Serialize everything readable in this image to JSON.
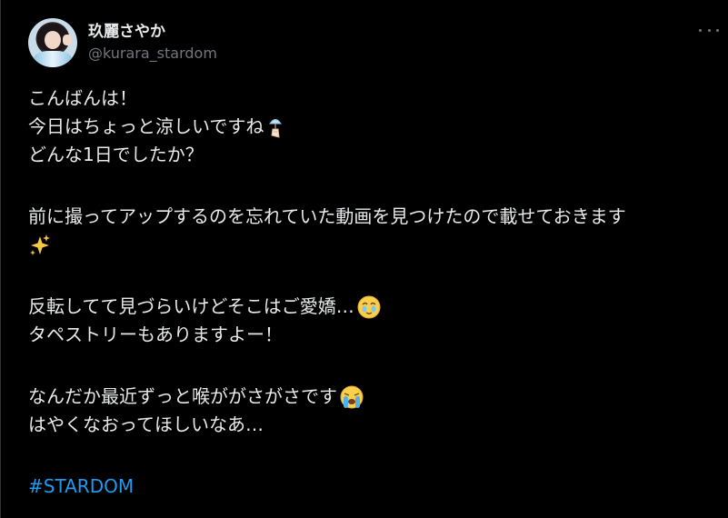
{
  "user": {
    "display_name": "玖麗さやか",
    "handle": "@kurara_stardom"
  },
  "post": {
    "lines": [
      "こんばんは！",
      "今日はちょっと涼しいですね",
      "どんな1日でしたか？",
      "前に撮ってアップするのを忘れていた動画を見つけたので載せておきます",
      "反転してて見づらいけどそこはご愛嬌…",
      "タペストリーもありますよー！",
      "なんだか最近ずっと喉ががさがさです",
      "はやくなおってほしいなあ…"
    ],
    "hashtag": "#STARDOM",
    "emojis": [
      "wind-chime-icon",
      "sparkles-icon",
      "teary-smile-icon",
      "crying-face-icon"
    ]
  },
  "colors": {
    "background": "#000000",
    "text": "#e7e9ea",
    "secondary": "#71767b",
    "link": "#1d9bf0"
  }
}
